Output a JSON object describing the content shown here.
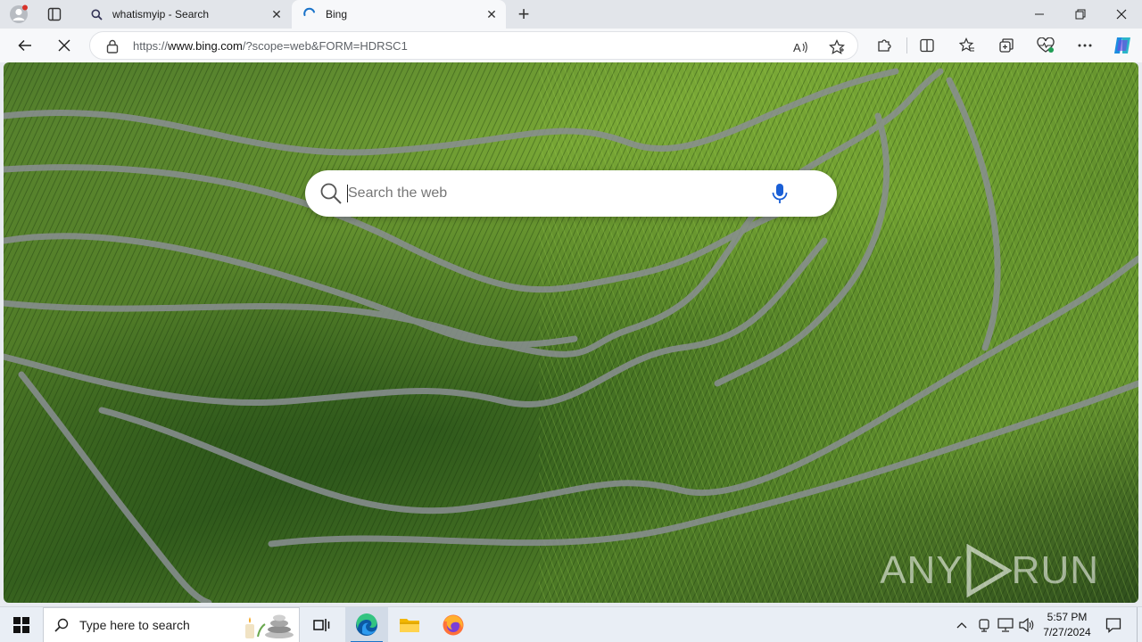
{
  "browser": {
    "tabs": [
      {
        "title": "whatismyip - Search",
        "icon": "search-icon",
        "active": false
      },
      {
        "title": "Bing",
        "icon": "loading-spinner-icon",
        "active": true
      }
    ],
    "address": {
      "url_prefix": "https://",
      "url_domain": "www.bing.com",
      "url_rest": "/?scope=web&FORM=HDRSC1"
    }
  },
  "page": {
    "search": {
      "placeholder": "Search the web",
      "value": ""
    },
    "watermark": {
      "left": "ANY",
      "right": "RUN"
    }
  },
  "taskbar": {
    "search_placeholder": "Type here to search",
    "apps": [
      "task-view-icon",
      "edge-icon",
      "file-explorer-icon",
      "firefox-icon"
    ],
    "clock": {
      "time": "5:57 PM",
      "date": "7/27/2024"
    }
  },
  "colors": {
    "accent": "#1a73c9",
    "tab_strip": "#e2e5ea",
    "toolbar": "#f7f8fa",
    "mic": "#1a5fd6"
  }
}
